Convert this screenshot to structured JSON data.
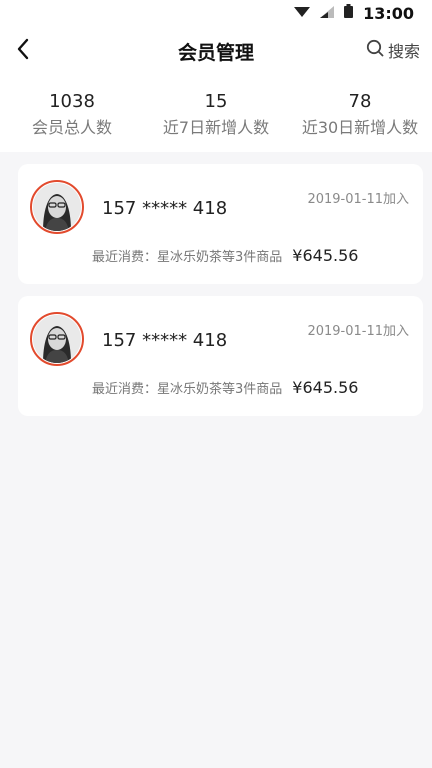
{
  "status": {
    "time": "13:00",
    "wifi_icon": "wifi-icon",
    "signal_icon": "signal-icon",
    "battery_icon": "battery-icon"
  },
  "header": {
    "title": "会员管理",
    "search_label": "搜索"
  },
  "stats": [
    {
      "value": "1038",
      "label": "会员总人数"
    },
    {
      "value": "15",
      "label": "近7日新增人数"
    },
    {
      "value": "78",
      "label": "近30日新增人数"
    }
  ],
  "members": [
    {
      "phone": "157 ***** 418",
      "joined": "2019-01-11加入",
      "recent_label": "最近消费：星冰乐奶茶等3件商品",
      "price": "¥645.56"
    },
    {
      "phone": "157 ***** 418",
      "joined": "2019-01-11加入",
      "recent_label": "最近消费：星冰乐奶茶等3件商品",
      "price": "¥645.56"
    }
  ],
  "colors": {
    "accent": "#e24a2d",
    "background": "#f6f6f8"
  }
}
